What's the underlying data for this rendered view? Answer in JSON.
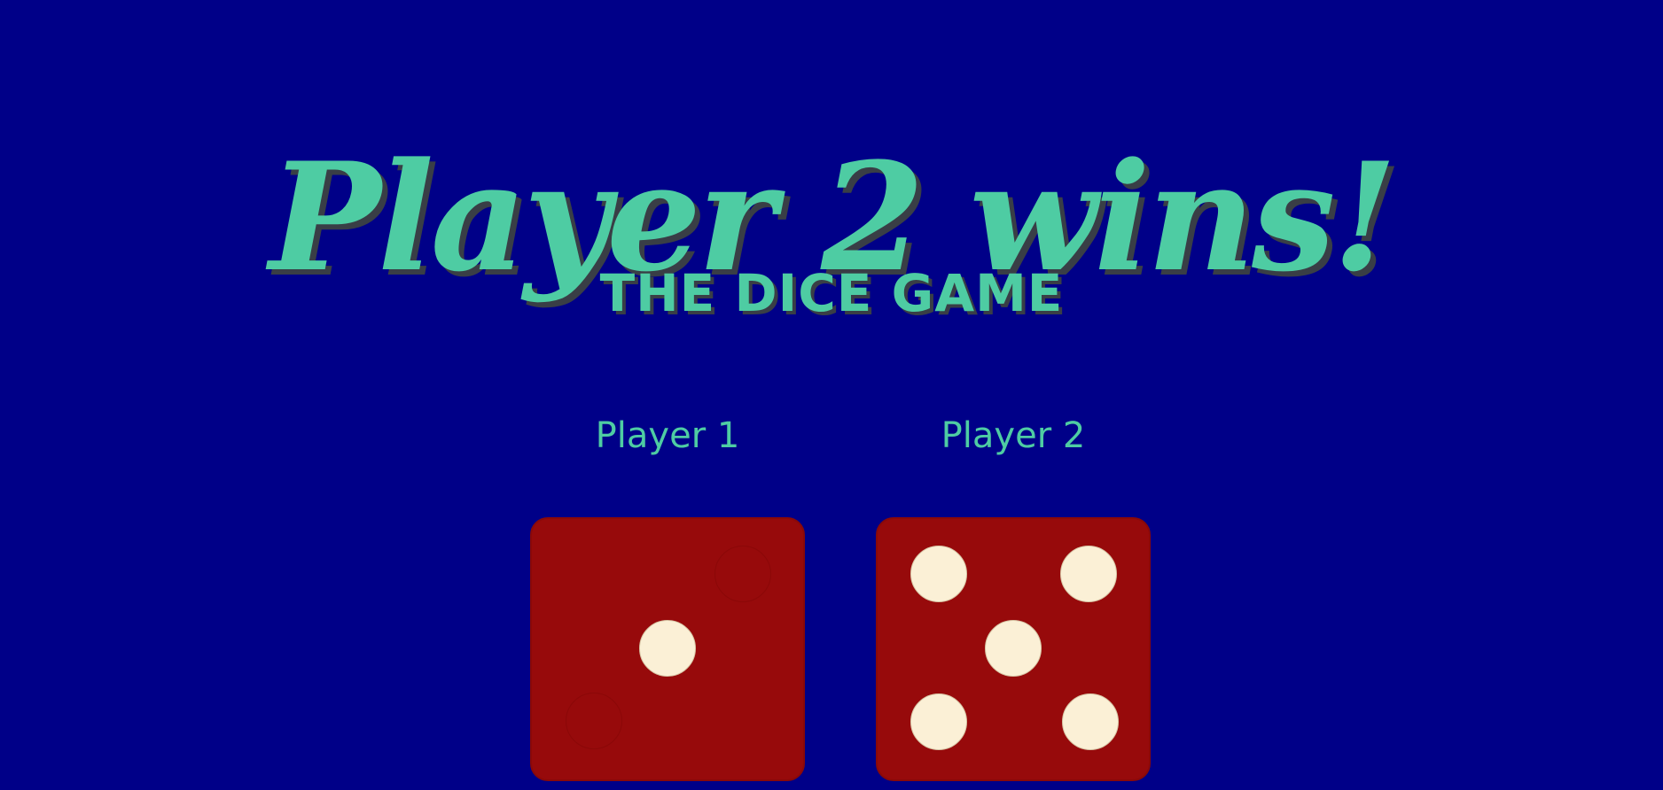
{
  "headline": "Player 2 wins!",
  "subtitle": "THE DICE GAME",
  "players": [
    {
      "label": "Player 1",
      "die_value": 1
    },
    {
      "label": "Player 2",
      "die_value": 5
    }
  ],
  "colors": {
    "background": "#000088",
    "text_accent": "#4ecca3",
    "text_shadow": "#393e46",
    "die": "#970a0b",
    "pip": "#fbf0d6"
  }
}
